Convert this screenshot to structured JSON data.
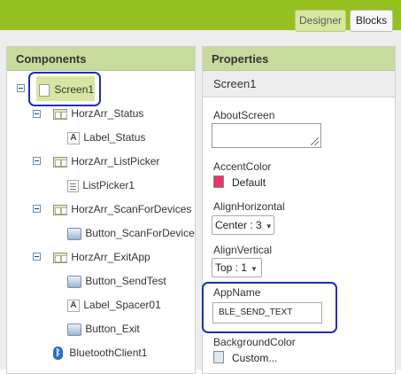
{
  "toolbar": {
    "designer_label": "Designer",
    "blocks_label": "Blocks"
  },
  "components": {
    "header": "Components",
    "items": [
      {
        "label": "Screen1"
      },
      {
        "label": "HorzArr_Status"
      },
      {
        "label": "Label_Status"
      },
      {
        "label": "HorzArr_ListPicker"
      },
      {
        "label": "ListPicker1"
      },
      {
        "label": "HorzArr_ScanForDevices"
      },
      {
        "label": "Button_ScanForDevice"
      },
      {
        "label": "HorzArr_ExitApp"
      },
      {
        "label": "Button_SendTest"
      },
      {
        "label": "Label_Spacer01"
      },
      {
        "label": "Button_Exit"
      },
      {
        "label": "BluetoothClient1"
      }
    ]
  },
  "properties": {
    "header": "Properties",
    "component_name": "Screen1",
    "about_screen": {
      "label": "AboutScreen",
      "value": ""
    },
    "accent_color": {
      "label": "AccentColor",
      "value": "Default",
      "color": "#e8336b"
    },
    "align_horizontal": {
      "label": "AlignHorizontal",
      "value": "Center : 3"
    },
    "align_vertical": {
      "label": "AlignVertical",
      "value": "Top : 1"
    },
    "app_name": {
      "label": "AppName",
      "value": "BLE_SEND_TEXT"
    },
    "background_color": {
      "label": "BackgroundColor",
      "value": "Custom...",
      "color": "#dde8f3"
    }
  },
  "colors": {
    "brand_green": "#94c11f",
    "header_green": "#c7dc9c",
    "highlight_blue": "#1f2fb5"
  }
}
